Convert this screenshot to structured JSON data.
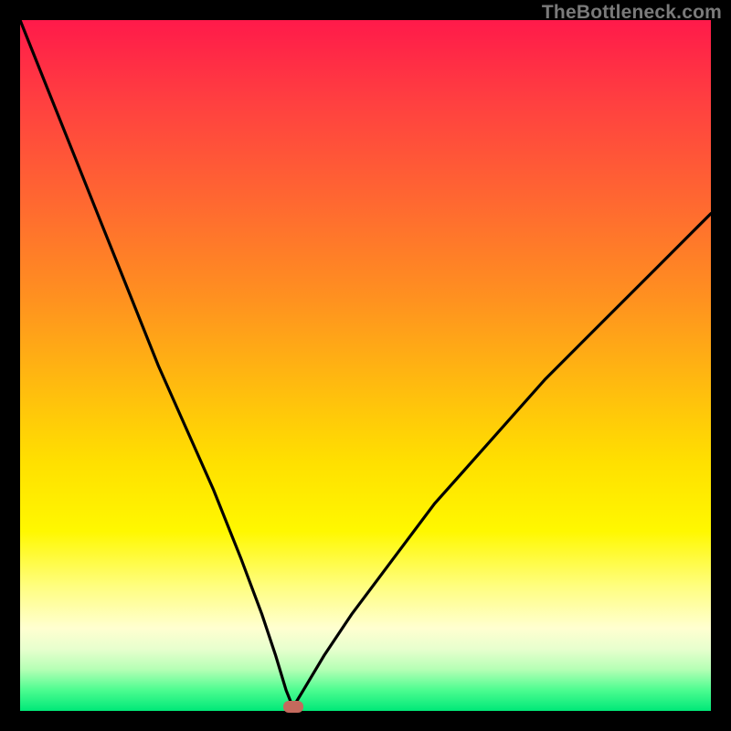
{
  "attribution": "TheBottleneck.com",
  "colors": {
    "background": "#000000",
    "gradient_top": "#ff1a4a",
    "gradient_bottom": "#00e878",
    "curve": "#000000",
    "marker": "#c46a5d",
    "attribution_text": "#7a7a7a"
  },
  "chart_data": {
    "type": "line",
    "title": "",
    "xlabel": "",
    "ylabel": "",
    "xlim": [
      0,
      100
    ],
    "ylim": [
      0,
      100
    ],
    "note": "V-shaped bottleneck curve. y≈0 is optimal (green), y≈100 is worst (red). Minimum near x≈39.",
    "series": [
      {
        "name": "bottleneck-curve",
        "x": [
          0,
          4,
          8,
          12,
          16,
          20,
          24,
          28,
          32,
          35,
          37,
          38.5,
          39.5,
          41,
          44,
          48,
          54,
          60,
          68,
          76,
          84,
          92,
          100
        ],
        "y": [
          100,
          90,
          80,
          70,
          60,
          50,
          41,
          32,
          22,
          14,
          8,
          3,
          0.5,
          3,
          8,
          14,
          22,
          30,
          39,
          48,
          56,
          64,
          72
        ]
      }
    ],
    "marker": {
      "x": 39.5,
      "y": 0.5
    }
  }
}
